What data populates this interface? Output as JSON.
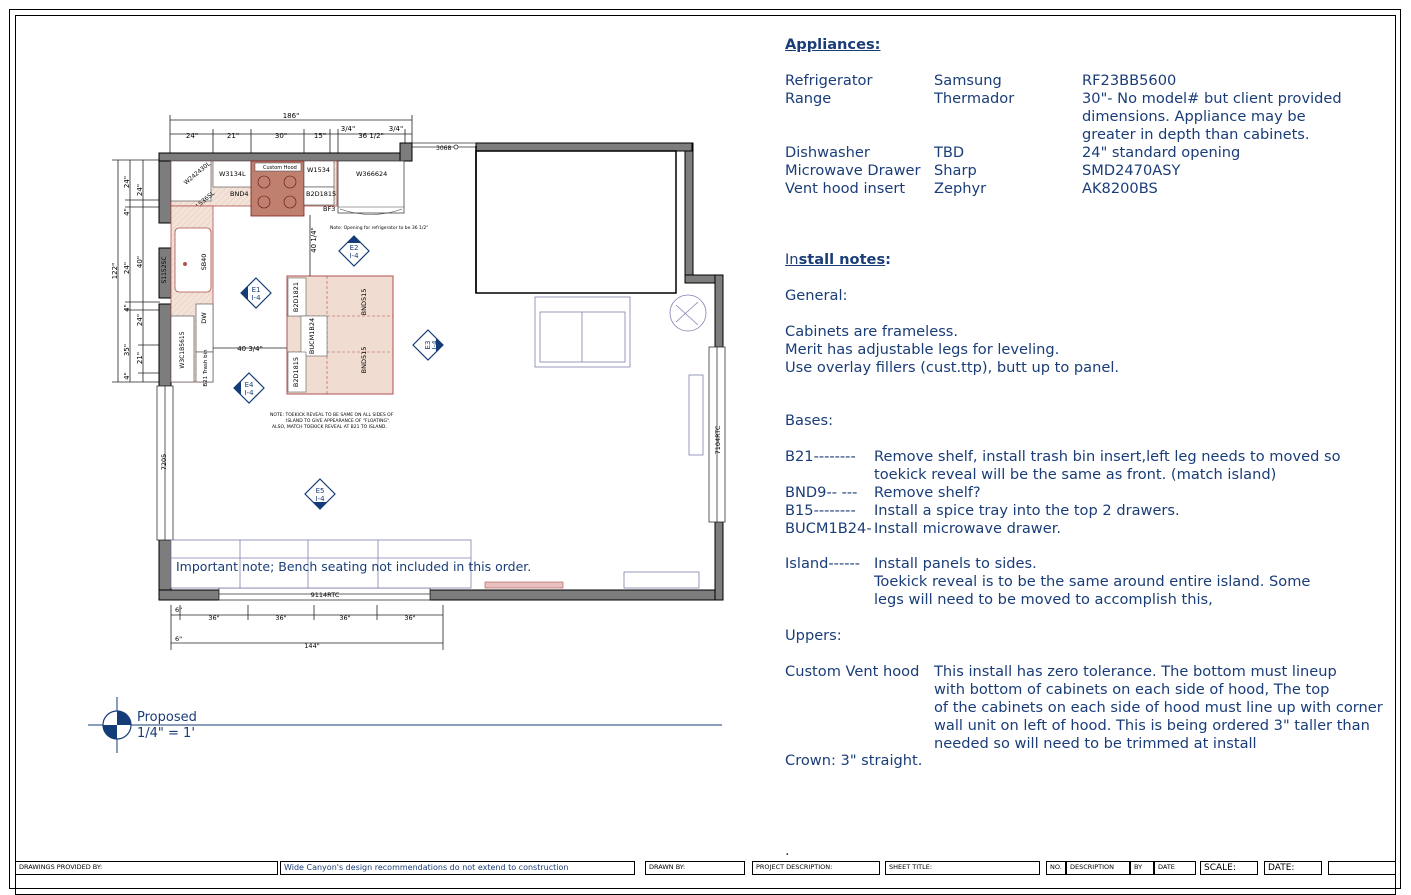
{
  "plan": {
    "dimensions": {
      "top_overall": "186\"",
      "top_segments": [
        "24\"",
        "21\"",
        "30\"",
        "15\"",
        "3/4\"",
        "36 1/2\"",
        "3/4\""
      ],
      "left_overall": "122\"",
      "left_segments": [
        "24\"",
        "4\"",
        "24\"",
        "4\"",
        "40\"",
        "4\"",
        "24\"",
        "4\"",
        "35\"",
        "21\"",
        "4\""
      ],
      "island_to_range": "40 1/4\"",
      "island_to_wall": "40 3/4\"",
      "bottom_segments": [
        "36\"",
        "36\"",
        "36\"",
        "36\""
      ],
      "bottom_small": [
        "6\"",
        "6\""
      ],
      "bottom_overall": "144\"",
      "right_window": "7104RTC",
      "left_window": "7205",
      "bottom_window": "9114RTC",
      "top_door": "3068"
    },
    "cabinet_labels": {
      "corner": "W242430L",
      "wall_left": "W3134L",
      "hood": "Custom Hood",
      "wall_right": "W1534",
      "fridge_wall": "W366624",
      "bnd": "BND4",
      "lazy": "LS36SL",
      "b15": "B2D1815",
      "bf": "BF3",
      "sink": "SB40",
      "sink_side": "S1152SC",
      "dw": "DW",
      "trash": "B21 Trash bin",
      "pantry": "W3C1B5615",
      "island_1": "B2D1821",
      "island_2": "BUCM1B24",
      "island_3": "B2D1815",
      "island_4": "BND515",
      "island_5": "BND515"
    },
    "notes": {
      "opening_note": "Note: Opening for refrigerator to be 36 1/2\"",
      "island_note_1": "NOTE: TOEKICK REVEAL TO BE SAME ON ALL SIDES OF",
      "island_note_2": "ISLAND TO GIVE APPEARANCE OF \"FLOATING\".",
      "island_note_3": "ALSO, MATCH TOEKICK REVEAL AT B21 TO ISLAND."
    },
    "elevation_markers": [
      {
        "id": "E1",
        "sheet": "I-4"
      },
      {
        "id": "E2",
        "sheet": "I-4"
      },
      {
        "id": "E3",
        "sheet": "I-4"
      },
      {
        "id": "E4",
        "sheet": "I-4"
      },
      {
        "id": "E5",
        "sheet": "I-4"
      }
    ],
    "important_note": "Important note;  Bench seating not included in this order.",
    "scale_label": "Proposed",
    "scale_value": "1/4\" = 1'"
  },
  "appliances": {
    "heading": "Appliances:",
    "rows": [
      {
        "item": "Refrigerator",
        "brand": "Samsung",
        "model": [
          "RF23BB5600"
        ]
      },
      {
        "item": "Range",
        "brand": "Thermador",
        "model": [
          "30\"- No model# but client provided",
          "dimensions. Appliance may be",
          "greater in depth than cabinets."
        ]
      },
      {
        "item": "Dishwasher",
        "brand": "TBD",
        "model": [
          "24\" standard opening"
        ]
      },
      {
        "item": "Microwave Drawer",
        "brand": "Sharp",
        "model": [
          "SMD2470ASY"
        ]
      },
      {
        "item": "Vent hood insert",
        "brand": "Zephyr",
        "model": [
          "AK8200BS"
        ]
      }
    ]
  },
  "install": {
    "heading_first": "In",
    "heading_rest": "stall notes",
    "heading_colon": ":",
    "general_label": "General:",
    "general": [
      "Cabinets are frameless.",
      "Merit has adjustable legs for leveling.",
      "Use overlay fillers (cust.ttp), butt up to panel."
    ],
    "bases_label": "Bases:",
    "bases": [
      {
        "key": "B21--------",
        "text": [
          "Remove shelf, install trash bin insert,left leg needs to moved so",
          "toekick reveal will be the same as front. (match island)"
        ]
      },
      {
        "key": "BND9-- ---",
        "text": [
          "Remove shelf?"
        ]
      },
      {
        "key": "B15--------",
        "text": [
          "Install a spice tray into the top 2 drawers."
        ]
      },
      {
        "key": "BUCM1B24-",
        "text": [
          "Install microwave drawer."
        ]
      }
    ],
    "island_key": "Island------",
    "island": [
      "Install panels to sides.",
      "Toekick reveal is to be the same around entire island. Some",
      "legs will need to be moved to accomplish this,"
    ],
    "uppers_label": "Uppers:",
    "vent_key": "Custom Vent hood",
    "vent": [
      "This install has zero tolerance.  The bottom must lineup",
      "with bottom of cabinets on each side of hood,  The top",
      "of the cabinets on each side of hood must line up with corner",
      "wall unit on left of hood.  This is being ordered 3\" taller than",
      "needed so will need to be trimmed at install"
    ],
    "crown": "Crown: 3\" straight.",
    "dot": "."
  },
  "title_block": {
    "drawings_by": "DRAWINGS PROVIDED BY:",
    "disclaimer": "Wide Canyon's design recommendations do not extend to construction",
    "drawn_by": "DRAWN BY:",
    "project_desc": "PROJECT DESCRIPTION:",
    "sheet_title": "SHEET TITLE:",
    "no": "NO.",
    "description": "DESCRIPTION",
    "by": "BY",
    "date_small": "DATE",
    "scale": "SCALE:",
    "date": "DATE:"
  },
  "colors": {
    "text_blue": "#1a3d78",
    "plan_blue": "#143c78",
    "wall_gray": "#7d7d7d",
    "cabinet_tan": "#f0dcd0",
    "cabinet_line": "#b05050"
  }
}
